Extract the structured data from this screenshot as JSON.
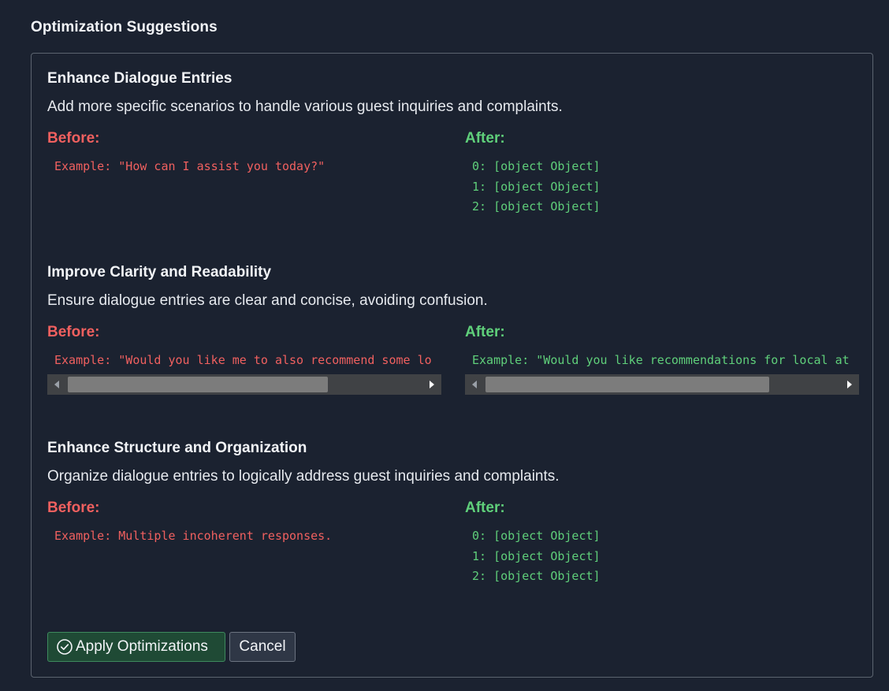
{
  "header": {
    "title": "Optimization Suggestions"
  },
  "sections": [
    {
      "title": "Enhance Dialogue Entries",
      "description": "Add more specific scenarios to handle various guest inquiries and complaints.",
      "before_label": "Before:",
      "before_text": "Example: \"How can I assist you today?\"",
      "after_label": "After:",
      "after_lines": [
        "0: [object Object]",
        "1: [object Object]",
        "2: [object Object]"
      ]
    },
    {
      "title": "Improve Clarity and Readability",
      "description": "Ensure dialogue entries are clear and concise, avoiding confusion.",
      "before_label": "Before:",
      "before_text": "Example: \"Would you like me to also recommend some lo",
      "after_label": "After:",
      "after_text": "Example: \"Would you like recommendations for local at"
    },
    {
      "title": "Enhance Structure and Organization",
      "description": "Organize dialogue entries to logically address guest inquiries and complaints.",
      "before_label": "Before:",
      "before_text": "Example: Multiple incoherent responses.",
      "after_label": "After:",
      "after_lines": [
        "0: [object Object]",
        "1: [object Object]",
        "2: [object Object]"
      ]
    }
  ],
  "actions": {
    "apply_label": "Apply Optimizations",
    "apply_icon": "check-circle-icon",
    "cancel_label": "Cancel"
  },
  "colors": {
    "background": "#1b2230",
    "before": "#f0605f",
    "after": "#5fcf7a",
    "apply_button": "#1f4a35"
  }
}
